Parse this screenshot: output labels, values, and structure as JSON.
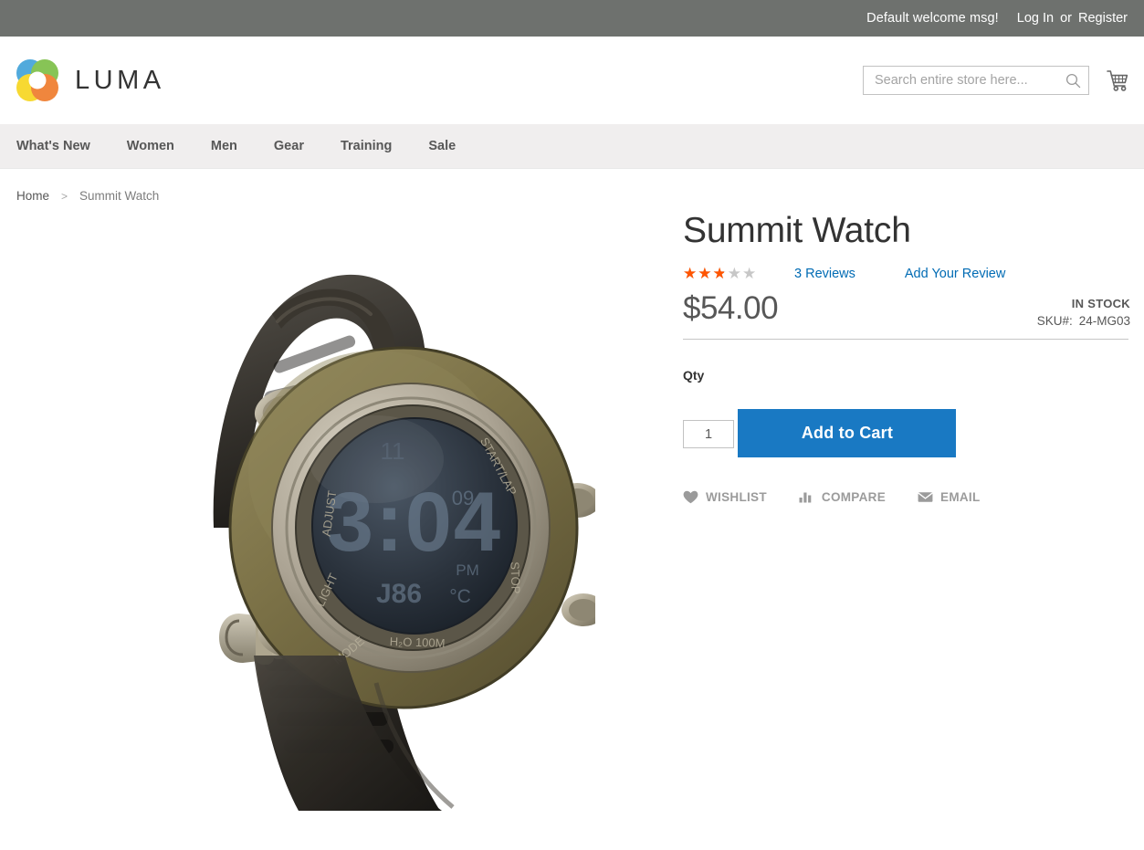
{
  "topbar": {
    "welcome_msg": "Default welcome msg!",
    "login_label": "Log In",
    "separator": "or",
    "register_label": "Register",
    "background_color": "#6e716e"
  },
  "header": {
    "logo_text": "LUMA",
    "logo_icon": "luma-flower-icon",
    "logo_colors": {
      "blue": "#3a9fd8",
      "green": "#77bc3f",
      "yellow": "#f6d416",
      "orange": "#ee7623"
    },
    "search": {
      "placeholder": "Search entire store here...",
      "value": "",
      "icon": "search-icon"
    },
    "cart": {
      "icon": "shopping-cart-icon",
      "count": ""
    }
  },
  "nav": {
    "items": [
      {
        "label": "What's New"
      },
      {
        "label": "Women"
      },
      {
        "label": "Men"
      },
      {
        "label": "Gear"
      },
      {
        "label": "Training"
      },
      {
        "label": "Sale"
      }
    ]
  },
  "breadcrumb": {
    "home": "Home",
    "separator": ">",
    "current": "Summit Watch"
  },
  "product": {
    "title": "Summit Watch",
    "image_alt": "Summit Watch digital sports watch with black strap and olive bezel",
    "rating": {
      "stars_filled": "★★★★★",
      "stars_empty": "★★★★★",
      "percent": 50,
      "value": 2.5,
      "max": 5
    },
    "reviews_link": "3 Reviews",
    "add_review_link": "Add Your Review",
    "price": "$54.00",
    "stock_status": "IN STOCK",
    "sku_label": "SKU#:",
    "sku_value": "24-MG03",
    "qty_label": "Qty",
    "qty_value": "1",
    "add_to_cart_label": "Add to Cart",
    "accent_color": "#1979c3",
    "link_color": "#006bb4",
    "star_color": "#ff5501",
    "actions": [
      {
        "label": "WISHLIST",
        "icon": "heart-icon"
      },
      {
        "label": "COMPARE",
        "icon": "compare-bars-icon"
      },
      {
        "label": "EMAIL",
        "icon": "envelope-icon"
      }
    ]
  }
}
